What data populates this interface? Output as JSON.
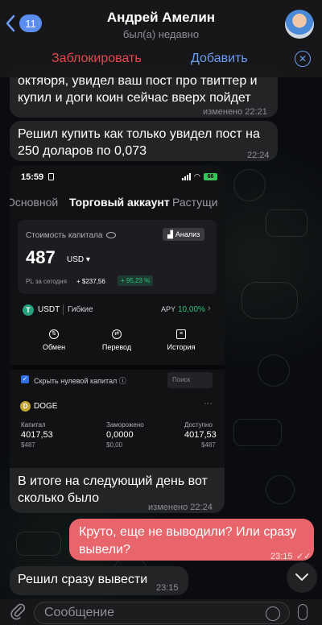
{
  "header": {
    "back_badge": "11",
    "contact_name": "Андрей Амелин",
    "contact_status": "был(а) недавно",
    "block_label": "Заблокировать",
    "add_label": "Добавить"
  },
  "messages": [
    {
      "text_line1": "октября, увидел ваш пост про твиттер и",
      "text_line2": "купил и доги коин сейчас вверх пойдет",
      "meta": "изменено 22:21"
    },
    {
      "text_line1": "Решил купить как только увидел пост на",
      "text_line2": "250 доларов по 0,073",
      "meta": "22:24"
    }
  ],
  "screenshot": {
    "status_time": "15:59",
    "battery": "66",
    "tabs": [
      "Основной",
      "Торговый аккаунт",
      "Растущи"
    ],
    "capital_label": "Стоимость капитала",
    "analysis_label": "Анализ",
    "capital_value": "487",
    "capital_currency": "USD ▾",
    "pl_label": "PL за сегодня",
    "pl_value": "+ $237,56",
    "pl_pct": "+ 95,23 %",
    "usdt_name": "USDT",
    "usdt_type": "Гибкие",
    "apy_label": "APY",
    "apy_value": "10,00%",
    "actions": [
      "Обмен",
      "Перевод",
      "История"
    ],
    "hide_label": "Скрыть нулевой капитал ⓘ",
    "search_placeholder": "Поиск",
    "doge_name": "DOGE",
    "columns": [
      {
        "label": "Капитал",
        "value": "4017,53",
        "sub": "$487"
      },
      {
        "label": "Заморожено",
        "value": "0,0000",
        "sub": "$0,00"
      },
      {
        "label": "Доступно",
        "value": "4017,53",
        "sub": "$487"
      }
    ],
    "caption_line1": "В итоге на следующий день вот",
    "caption_line2": "сколько было",
    "caption_meta": "изменено 22:24"
  },
  "outgoing": {
    "text_line1": "Круто, еще не выводили? Или сразу",
    "text_line2": "вывели?",
    "meta": "23:15"
  },
  "last_message": {
    "text": "Решил сразу вывести",
    "meta": "23:15"
  },
  "composer": {
    "placeholder": "Сообщение"
  },
  "colors": {
    "accent": "#6d9cf2",
    "danger": "#e5484d",
    "outgoing_bubble": "#e8656c",
    "incoming_bubble": "#222426",
    "positive": "#2ec27e"
  }
}
